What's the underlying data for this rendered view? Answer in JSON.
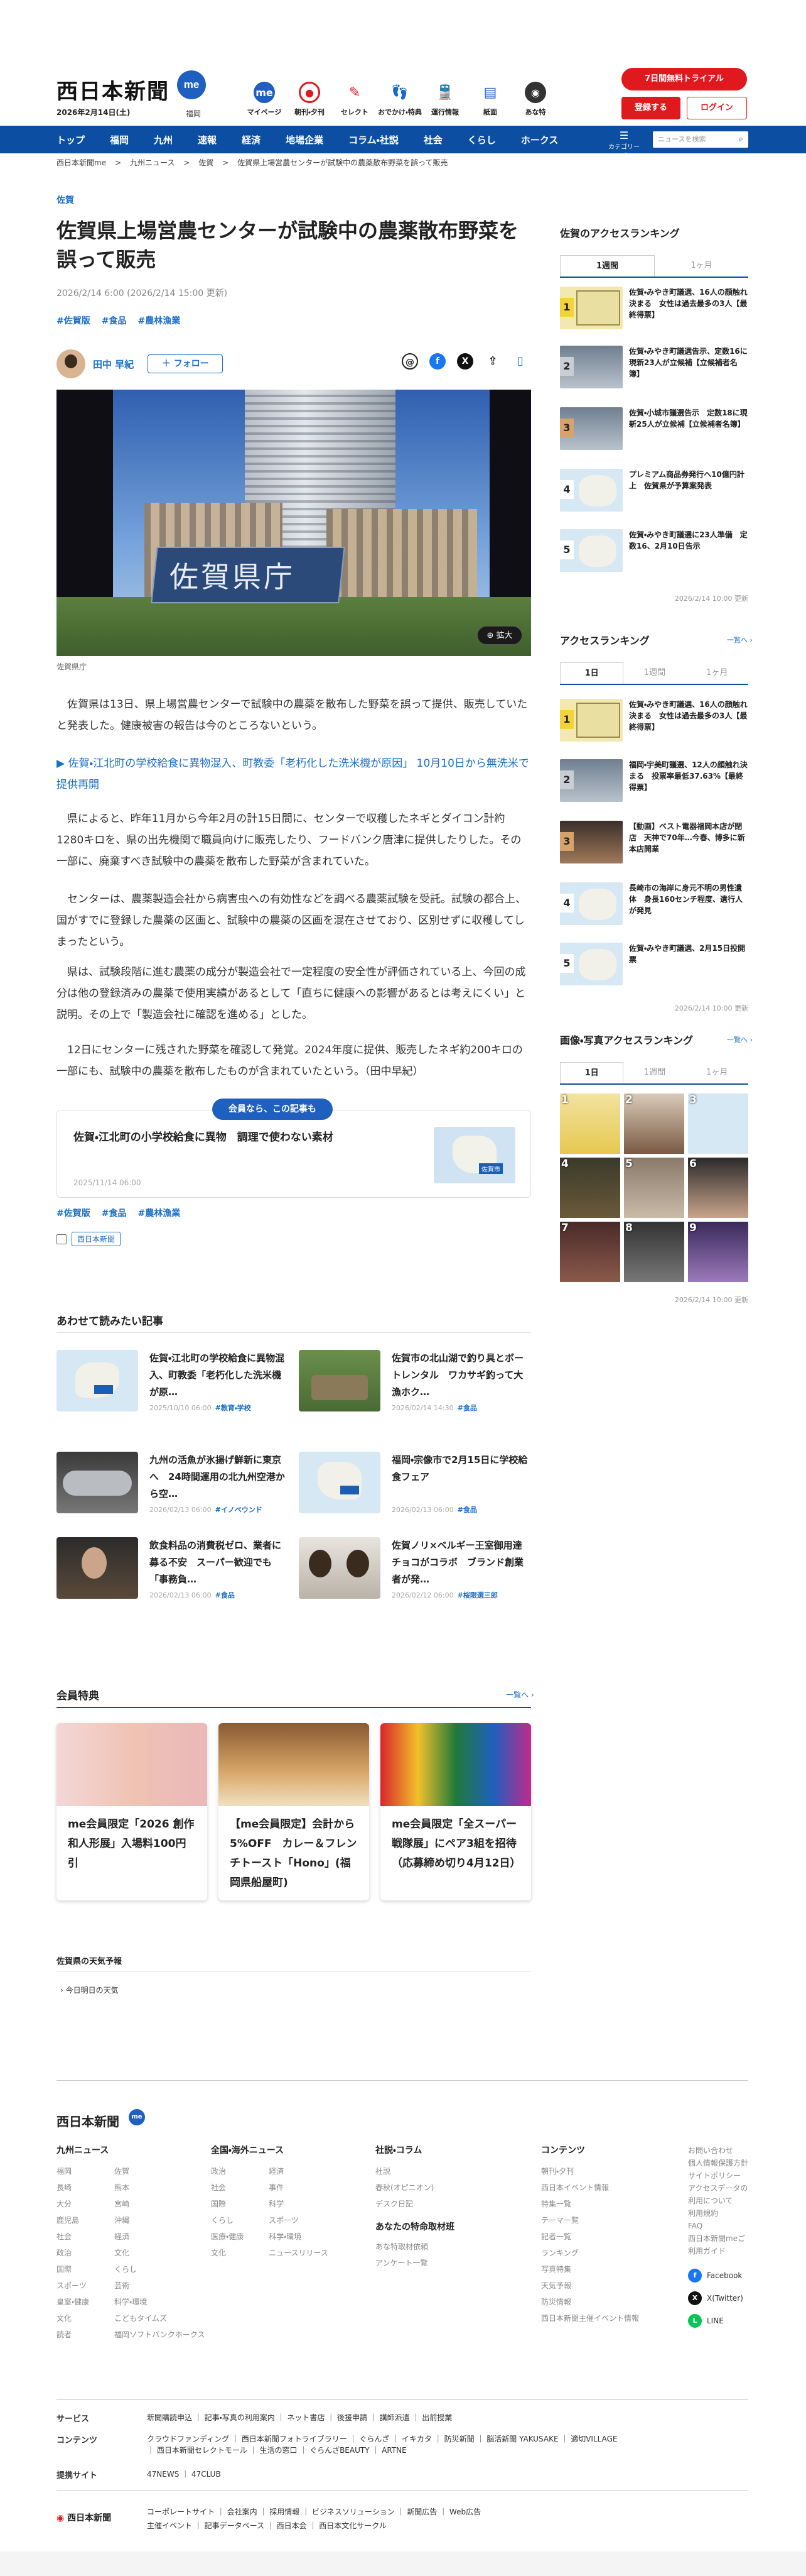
{
  "header": {
    "logo": "西日本新聞",
    "logo_badge": "me",
    "date": "2026年2月14日(土)",
    "region": "福岡",
    "icons": [
      "マイページ",
      "朝刊・夕刊",
      "セレクト",
      "おでかけ・特典",
      "運行情報",
      "紙面",
      "あな特"
    ],
    "trial": "7日間無料トライアル",
    "register": "登録する",
    "login": "ログイン"
  },
  "nav": {
    "items": [
      "トップ",
      "福岡",
      "九州",
      "速報",
      "経済",
      "地場企業",
      "コラム・社説",
      "社会",
      "くらし",
      "ホークス"
    ],
    "category": "カテゴリー一覧",
    "search_placeholder": "ニュースを検索"
  },
  "breadcrumb": [
    "西日本新聞me",
    "九州ニュース",
    "佐賀",
    "佐賀県上場営農センターが試験中の農薬散布野菜を誤って販売"
  ],
  "article": {
    "category": "佐賀",
    "title": "佐賀県上場営農センターが試験中の農薬散布野菜を誤って販売",
    "date": "2026/2/14 6:00 (2026/2/14 15:00 更新)",
    "tags": [
      "#佐賀版",
      "#食品",
      "#農林漁業"
    ],
    "author": "田中 早紀",
    "follow": "フォロー",
    "photo_sign": "佐賀県庁",
    "photo_caption": "佐賀県庁",
    "zoom": "拡大",
    "p1": "佐賀県は13日、県上場営農センターで試験中の農薬を散布した野菜を誤って提供、販売していたと発表した。健康被害の報告は今のところないという。",
    "related_inline": "▶ 佐賀・江北町の学校給食に異物混入、町教委「老朽化した洗米機が原因」 10月10日から無洗米で提供再開",
    "p2": "県によると、昨年11月から今年2月の計15日間に、センターで収穫したネギとダイコン計約1280キロを、県の出先機関で職員向けに販売したり、フードバンク唐津に提供したりした。その一部に、廃棄すべき試験中の農薬を散布した野菜が含まれていた。",
    "p3": "センターは、農薬製造会社から病害虫への有効性などを調べる農薬試験を受託。試験の都合上、国がすでに登録した農薬の区画と、試験中の農薬の区画を混在させており、区別せずに収穫してしまったという。",
    "p4": "県は、試験段階に進む農薬の成分が製造会社で一定程度の安全性が評価されている上、今回の成分は他の登録済みの農薬で使用実績があるとして「直ちに健康への影響があるとは考えにくい」と説明。その上で「製造会社に確認を進める」とした。",
    "p5": "12日にセンターに残された野菜を確認して発覚。2024年度に提供、販売したネギ約200キロの一部にも、試験中の農薬を散布したものが含まれていたという。（田中早紀）",
    "member_pill": "会員なら、この記事も",
    "card_title": "佐賀・江北町の小学校給食に異物　調理で使わない素材",
    "card_date": "2025/11/14 06:00",
    "card_map_label": "佐賀市",
    "tags_bottom": [
      "#佐賀版",
      "#食品",
      "#農林漁業"
    ],
    "source": "西日本新聞"
  },
  "read_more": {
    "heading": "あわせて読みたい記事",
    "items": [
      {
        "title": "佐賀・江北町の学校給食に異物混入、町教委「老朽化した洗米機が原…",
        "date": "2025/10/10 06:00",
        "tag": "#教育・学校"
      },
      {
        "title": "佐賀市の北山湖で釣り具とボートレンタル　ワカサギ釣って大漁ホク…",
        "date": "2026/02/14 14:30",
        "tag": "#食品"
      },
      {
        "title": "九州の活魚が氷揚げ鮮新に東京へ　24時間運用の北九州空港から空…",
        "date": "2026/02/13 06:00",
        "tag": "#イノベウンド"
      },
      {
        "title": "福岡・宗像市で2月15日に学校給食フェア",
        "date": "2026/02/13 06:00",
        "tag": "#食品"
      },
      {
        "title": "飲食料品の消費税ゼロ、業者に募る不安　スーパー歓迎でも「事務負…",
        "date": "2026/02/13 06:00",
        "tag": "#食品"
      },
      {
        "title": "佐賀ノリ×ベルギー王室御用達チョコがコラボ　ブランド創業者が発…",
        "date": "2026/02/12 06:00",
        "tag": "#桜限選三郎"
      }
    ]
  },
  "perks": {
    "heading": "会員特典",
    "more": "一覧へ",
    "items": [
      {
        "title": "me会員限定「2026 創作和人形展」入場料100円引"
      },
      {
        "title": "【me会員限定】会計から5%OFF　カレー＆フレンチトースト「Hono」(福岡県船屋町)"
      },
      {
        "title": "me会員限定「全スーパー戦隊展」にペア3組を招待（応募締め切り4月12日）"
      }
    ]
  },
  "weather": {
    "heading": "佐賀県の天気予報",
    "sub": "今日明日の天気"
  },
  "sidebar": {
    "local_heading": "佐賀のアクセスランキング",
    "tabs": [
      "1週間",
      "1ヶ月"
    ],
    "local_items": [
      "佐賀・みやき町議選、16人の顔触れ決まる　女性は過去最多の3人【最終得票】",
      "佐賀・みやき町議選告示、定数16に現新23人が立候補【立候補者名簿】",
      "佐賀・小城市議選告示　定数18に現新25人が立候補【立候補者名簿】",
      "プレミアム商品券発行へ10億円計上　佐賀県が予算案発表",
      "佐賀・みやき町議選に23人準備　定数16、2月10日告示"
    ],
    "local_updated": "2026/2/14 10:00 更新",
    "access_heading": "アクセスランキング",
    "access_more": "一覧へ",
    "tabs2": [
      "1日",
      "1週間",
      "1ヶ月"
    ],
    "access_items": [
      "佐賀・みやき町議選、16人の顔触れ決まる　女性は過去最多の3人【最終得票】",
      "福岡・宇美町議選、12人の顔触れ決まる　投票率最低37.63%【最終得票】",
      "【動画】ベスト電器福岡本店が閉店　天神で70年…今春、博多に新本店開業",
      "長崎市の海岸に身元不明の男性遺体　身長160センチ程度、遺行人が発見",
      "佐賀・みやき町議選、2月15日投開票"
    ],
    "access_updated": "2026/2/14 10:00 更新",
    "photo_heading": "画像・写真アクセスランキング",
    "photo_more": "一覧へ",
    "tabs3": [
      "1日",
      "1週間",
      "1ヶ月"
    ],
    "photo_updated": "2026/2/14 10:00 更新"
  },
  "footer": {
    "logo": "西日本新聞",
    "col1_head": "九州ニュース",
    "col1_a": [
      "福岡",
      "長崎",
      "大分",
      "鹿児島",
      "社会",
      "政治",
      "国際",
      "スポーツ",
      "皇室・健康",
      "文化",
      "読者"
    ],
    "col1_b": [
      "佐賀",
      "熊本",
      "宮崎",
      "沖縄",
      "経済",
      "文化",
      "くらし",
      "芸術",
      "科学・環境",
      "こどもタイムズ",
      "福岡ソフトバンクホークス"
    ],
    "col2_head": "全国・海外ニュース",
    "col2_a": [
      "政治",
      "社会",
      "国際",
      "くらし",
      "医療・健康",
      "文化"
    ],
    "col2_b": [
      "経済",
      "事件",
      "科学",
      "スポーツ",
      "科学・環境",
      "ニュースリリース"
    ],
    "col3_head": "社説・コラム",
    "col3": [
      "社説",
      "春秋(オピニオン)",
      "デスク日記"
    ],
    "col3_sub": "あなたの特命取材班",
    "col3_b": [
      "あな特取材依頼",
      "アンケート一覧"
    ],
    "col4_head": "コンテンツ",
    "col4": [
      "朝刊・夕刊",
      "西日本イベント情報",
      "特集一覧",
      "テーマ一覧",
      "記者一覧",
      "ランキング",
      "写真特集",
      "天気予報",
      "防災情報",
      "西日本新聞主催イベント情報"
    ],
    "col5": [
      "お問い合わせ",
      "個人情報保護方針",
      "サイトポリシー",
      "アクセスデータの利用について",
      "利用規約",
      "FAQ",
      "西日本新聞meご利用ガイド"
    ],
    "sns": [
      "Facebook",
      "X(Twitter)",
      "LINE"
    ],
    "services": [
      {
        "k": "サービス",
        "v": "新聞購読申込 ｜ 記事・写真の利用案内 ｜ ネット書店 ｜ 後援申請 ｜ 講師派遣 ｜ 出前授業"
      },
      {
        "k": "コンテンツ",
        "v": "クラウドファンディング ｜ 西日本新聞フォトライブラリー ｜ ぐらんざ ｜ イキカタ ｜ 防災新聞 ｜ 脳活新聞 YAKUSAKE ｜ 適切VILLAGE ｜ 西日本新聞セレクトモール ｜ 生活の窓口 ｜ ぐらんざBEAUTY ｜ ARTNE"
      },
      {
        "k": "提携サイト",
        "v": "47NEWS ｜ 47CLUB"
      }
    ],
    "corp": "コーポレートサイト ｜ 会社案内 ｜ 採用情報 ｜ ビジネスソリューション ｜ 新聞広告 ｜ Web広告\n主催イベント ｜ 記事データベース ｜ 西日本会 ｜ 西日本文化サークル"
  }
}
